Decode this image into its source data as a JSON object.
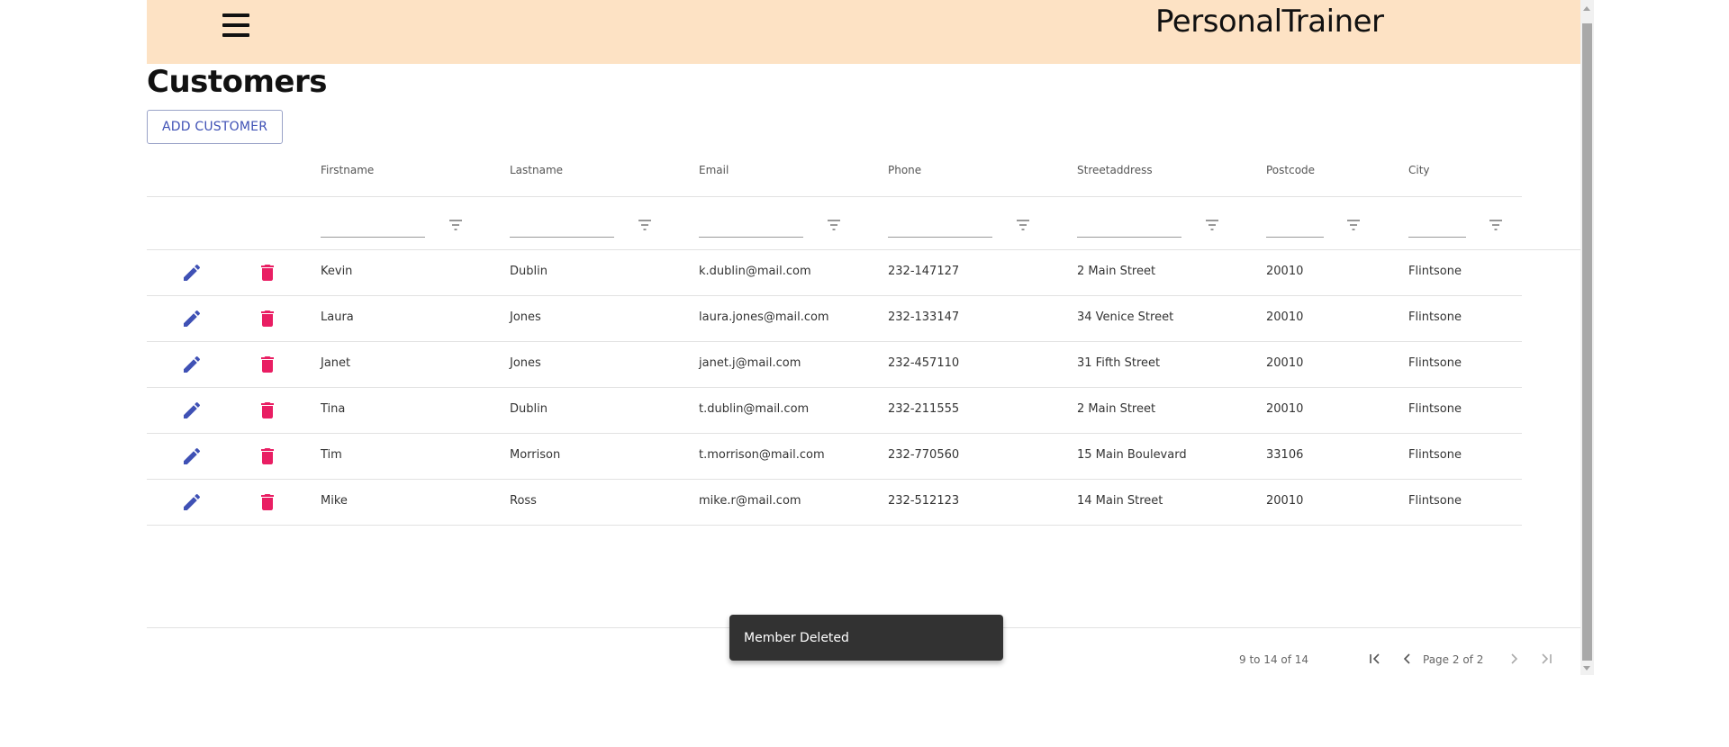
{
  "app": {
    "title": "PersonalTrainer",
    "header_bg": "#fde2c4"
  },
  "page": {
    "title": "Customers",
    "add_button_label": "ADD CUSTOMER"
  },
  "table": {
    "columns": [
      "Firstname",
      "Lastname",
      "Email",
      "Phone",
      "Streetaddress",
      "Postcode",
      "City"
    ],
    "filter_placeholders": [
      "",
      "",
      "",
      "",
      "",
      "",
      ""
    ],
    "rows": [
      [
        "Kevin",
        "Dublin",
        "k.dublin@mail.com",
        "232-147127",
        "2 Main Street",
        "20010",
        "Flintsone"
      ],
      [
        "Laura",
        "Jones",
        "laura.jones@mail.com",
        "232-133147",
        "34 Venice Street",
        "20010",
        "Flintsone"
      ],
      [
        "Janet",
        "Jones",
        "janet.j@mail.com",
        "232-457110",
        "31 Fifth Street",
        "20010",
        "Flintsone"
      ],
      [
        "Tina",
        "Dublin",
        "t.dublin@mail.com",
        "232-211555",
        "2 Main Street",
        "20010",
        "Flintsone"
      ],
      [
        "Tim",
        "Morrison",
        "t.morrison@mail.com",
        "232-770560",
        "15 Main Boulevard",
        "33106",
        "Flintsone"
      ],
      [
        "Mike",
        "Ross",
        "mike.r@mail.com",
        "232-512123",
        "14 Main Street",
        "20010",
        "Flintsone"
      ]
    ],
    "row_action_icons": {
      "edit": "pencil-icon",
      "delete": "trash-icon"
    },
    "colors": {
      "edit": "#3f51b5",
      "delete": "#e91e63"
    }
  },
  "pagination": {
    "summary": "9 to 14 of 14",
    "page_label": "Page 2 of 2"
  },
  "snackbar": {
    "message": "Member Deleted"
  }
}
